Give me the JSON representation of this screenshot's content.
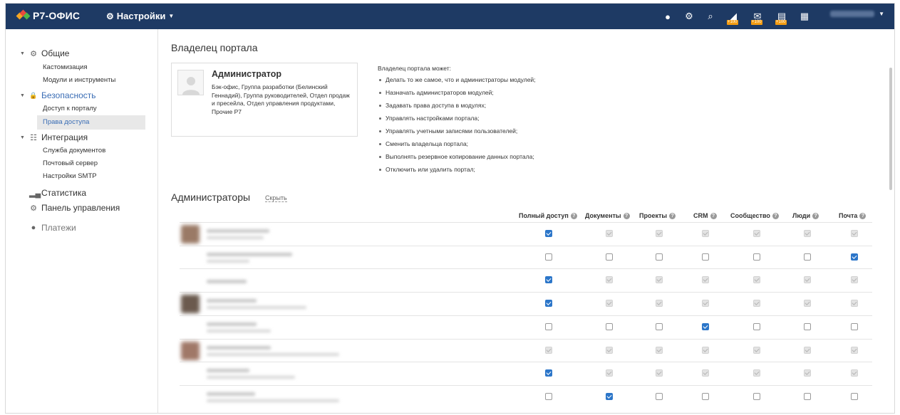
{
  "app": {
    "logo_text": "Р7-ОФИС",
    "settings_menu_label": "Настройки"
  },
  "topbar_icons": [
    {
      "name": "payments-icon",
      "glyph": "●"
    },
    {
      "name": "settings-gear-icon",
      "glyph": "⚙"
    },
    {
      "name": "search-icon",
      "glyph": "⌕"
    },
    {
      "name": "crm-module-icon",
      "glyph": "◢",
      "badge": "+100"
    },
    {
      "name": "mail-module-icon",
      "glyph": "✉",
      "badge": "+100"
    },
    {
      "name": "documents-module-icon",
      "glyph": "▤",
      "badge": "+100"
    },
    {
      "name": "calendar-icon",
      "glyph": "▦"
    }
  ],
  "colors": {
    "topbar": "#1e3a64",
    "accent": "#3a6db5",
    "checkbox_checked": "#2c76c9"
  },
  "sidebar": {
    "categories": [
      {
        "name": "Общие",
        "icon": "gear-icon",
        "expanded": true,
        "items": [
          "Кастомизация",
          "Модули и инструменты"
        ]
      },
      {
        "name": "Безопасность",
        "icon": "lock-icon",
        "expanded": true,
        "active": true,
        "items": [
          "Доступ к порталу",
          "Права доступа"
        ],
        "selected_item": "Права доступа"
      },
      {
        "name": "Интеграция",
        "icon": "grid-icon",
        "expanded": true,
        "items": [
          "Служба документов",
          "Почтовый сервер",
          "Настройки SMTP"
        ]
      },
      {
        "name": "Статистика",
        "icon": "chart-icon"
      },
      {
        "name": "Панель управления",
        "icon": "control-panel-icon"
      },
      {
        "name": "Платежи",
        "icon": "payments-icon"
      }
    ]
  },
  "owner": {
    "heading": "Владелец портала",
    "name": "Администратор",
    "groups": "Бэк-офис, Группа разработки (Белинский Геннадий), Группа руководителей, Отдел продаж и пресейла, Отдел управления продуктами, Прочие Р7",
    "rights_title": "Владелец портала может:",
    "rights": [
      "Делать то же самое, что и администраторы модулей;",
      "Назначать администраторов модулей;",
      "Задавать права доступа в модулях;",
      "Управлять настройками портала;",
      "Управлять учетными записями пользователей;",
      "Сменить владельца портала;",
      "Выполнять резервное копирование данных портала;",
      "Отключить или удалить портал;"
    ]
  },
  "admins": {
    "heading": "Администраторы",
    "hide_link": "Скрыть",
    "columns": [
      "Полный доступ",
      "Документы",
      "Проекты",
      "CRM",
      "Сообщество",
      "Люди",
      "Почта"
    ],
    "rows": [
      {
        "states": [
          "checked",
          "disabled",
          "disabled",
          "disabled",
          "disabled",
          "disabled",
          "disabled"
        ]
      },
      {
        "states": [
          "unchecked",
          "unchecked",
          "unchecked",
          "unchecked",
          "unchecked",
          "unchecked",
          "checked"
        ]
      },
      {
        "states": [
          "checked",
          "disabled",
          "disabled",
          "disabled",
          "disabled",
          "disabled",
          "disabled"
        ]
      },
      {
        "states": [
          "checked",
          "disabled",
          "disabled",
          "disabled",
          "disabled",
          "disabled",
          "disabled"
        ]
      },
      {
        "states": [
          "unchecked",
          "unchecked",
          "unchecked",
          "checked",
          "unchecked",
          "unchecked",
          "unchecked"
        ]
      },
      {
        "states": [
          "disabled",
          "disabled",
          "disabled",
          "disabled",
          "disabled",
          "disabled",
          "disabled"
        ]
      },
      {
        "states": [
          "checked",
          "disabled",
          "disabled",
          "disabled",
          "disabled",
          "disabled",
          "disabled"
        ]
      },
      {
        "states": [
          "unchecked",
          "checked",
          "unchecked",
          "unchecked",
          "unchecked",
          "unchecked",
          "unchecked"
        ]
      }
    ]
  }
}
